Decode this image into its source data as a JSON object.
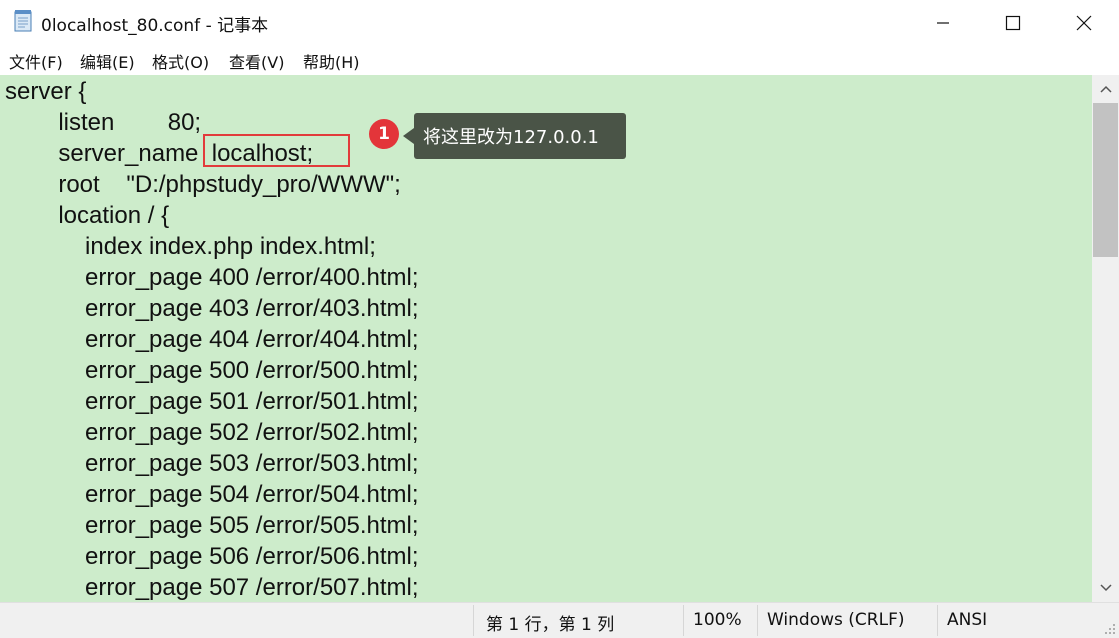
{
  "window": {
    "title": "0localhost_80.conf - 记事本",
    "icon": "notepad-icon",
    "controls": [
      "minimize-icon",
      "maximize-icon",
      "close-icon"
    ]
  },
  "menu": {
    "items": [
      "文件(F)",
      "编辑(E)",
      "格式(O)",
      "查看(V)",
      "帮助(H)"
    ]
  },
  "editor": {
    "background": "#cdeccb",
    "lines": [
      "server {",
      "        listen        80;",
      "        server_name  localhost;",
      "        root    \"D:/phpstudy_pro/WWW\";",
      "        location / {",
      "            index index.php index.html;",
      "            error_page 400 /error/400.html;",
      "            error_page 403 /error/403.html;",
      "            error_page 404 /error/404.html;",
      "            error_page 500 /error/500.html;",
      "            error_page 501 /error/501.html;",
      "            error_page 502 /error/502.html;",
      "            error_page 503 /error/503.html;",
      "            error_page 504 /error/504.html;",
      "            error_page 505 /error/505.html;",
      "            error_page 506 /error/506.html;",
      "            error_page 507 /error/507.html;"
    ]
  },
  "annotation": {
    "badge_number": "1",
    "callout_text": "将这里改为127.0.0.1",
    "highlight_color": "#e23b3b"
  },
  "status": {
    "position": "第 1 行，第 1 列",
    "zoom": "100%",
    "line_ending": "Windows (CRLF)",
    "encoding": "ANSI"
  }
}
